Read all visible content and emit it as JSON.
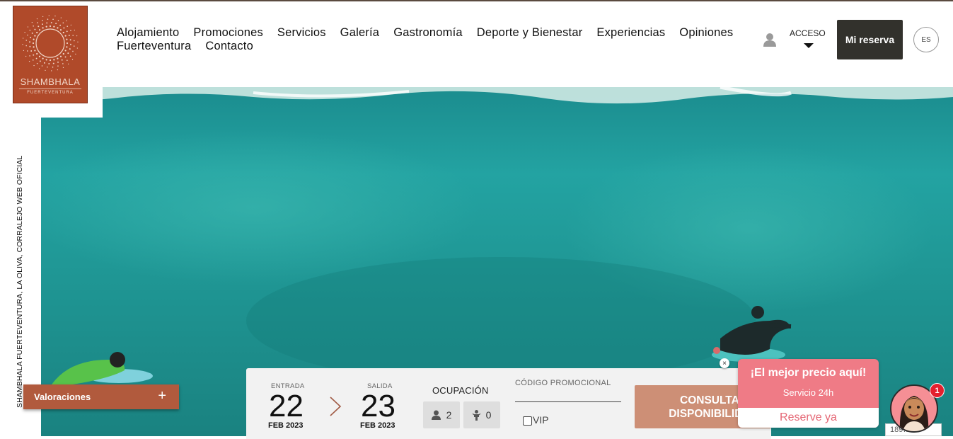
{
  "brand": {
    "name": "SHAMBHALA",
    "subtitle": "FUERTEVENTURA",
    "color": "#b04a2a"
  },
  "nav": {
    "items": [
      {
        "label": "Alojamiento"
      },
      {
        "label": "Promociones"
      },
      {
        "label": "Servicios"
      },
      {
        "label": "Galería"
      },
      {
        "label": "Gastronomía"
      },
      {
        "label": "Deporte y Bienestar"
      },
      {
        "label": "Experiencias"
      },
      {
        "label": "Opiniones"
      },
      {
        "label": "Fuerteventura"
      },
      {
        "label": "Contacto"
      }
    ]
  },
  "header": {
    "user_icon": "user-icon",
    "acceso_label": "ACCESO",
    "mi_reserva_label": "Mi reserva",
    "mi_reserva_color": "#32312c",
    "language": "ES"
  },
  "side_text": "SHAMBHALA FUERTEVENTURA, LA OLIVA, CORRALEJO WEB OFICIAL",
  "valoraciones": {
    "label": "Valoraciones",
    "toggle": "+",
    "color": "#b15a3d"
  },
  "booking": {
    "entrada": {
      "caption": "ENTRADA",
      "day": "22",
      "month": "FEB 2023"
    },
    "salida": {
      "caption": "SALIDA",
      "day": "23",
      "month": "FEB 2023"
    },
    "ocupacion": {
      "caption": "OCUPACIÓN",
      "adults": "2",
      "children": "0"
    },
    "promo": {
      "caption": "CÓDIGO PROMOCIONAL",
      "vip_label": "VIP",
      "vip_checked": false
    },
    "consultar_label": "CONSULTAR DISPONIBILIDAD",
    "consultar_color": "#cd8f76"
  },
  "promo_popup": {
    "title": "¡El mejor precio aquí!",
    "subtitle": "Servicio 24h",
    "button": "Reserve ya",
    "color": "#ef7b86",
    "close": "×"
  },
  "chat": {
    "badge_count": "1",
    "tag_text": "189…22"
  }
}
